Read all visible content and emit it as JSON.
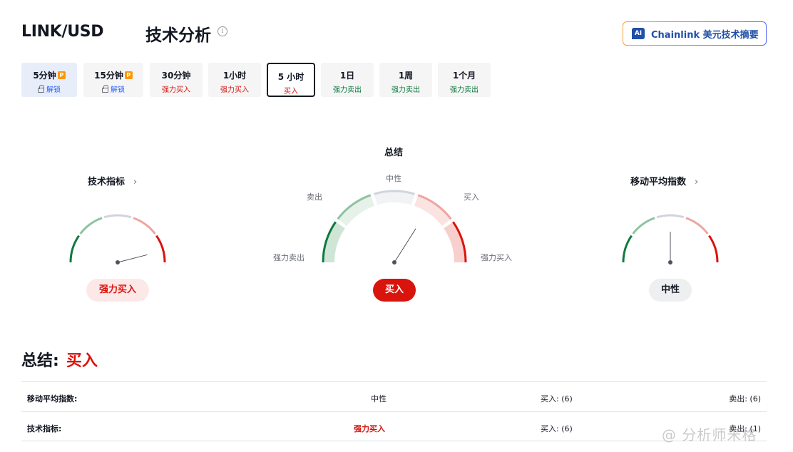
{
  "header": {
    "pair": "LINK/USD",
    "title": "技术分析",
    "info_icon": "i",
    "ai_button": {
      "badge": "AI",
      "label": "Chainlink 美元技术摘要"
    }
  },
  "tabs": [
    {
      "label": "5分钟",
      "sub": "解锁",
      "locked": true,
      "pro_badge": "P"
    },
    {
      "label": "15分钟",
      "sub": "解锁",
      "locked": true,
      "pro_badge": "P"
    },
    {
      "label": "30分钟",
      "sub": "强力买入",
      "sub_color": "red"
    },
    {
      "label": "1小时",
      "sub": "强力买入",
      "sub_color": "red"
    },
    {
      "label": "5 小时",
      "sub": "买入",
      "sub_color": "red",
      "active": true
    },
    {
      "label": "1日",
      "sub": "强力卖出",
      "sub_color": "green"
    },
    {
      "label": "1周",
      "sub": "强力卖出",
      "sub_color": "green"
    },
    {
      "label": "1个月",
      "sub": "强力卖出",
      "sub_color": "green"
    }
  ],
  "gauges": {
    "oscillators": {
      "title": "技术指标",
      "chevron": "›",
      "result": "强力买入",
      "level": 0.92
    },
    "summary": {
      "title": "总结",
      "labels": {
        "strong_sell": "强力卖出",
        "sell": "卖出",
        "neutral": "中性",
        "buy": "买入",
        "strong_buy": "强力买入"
      },
      "result": "买入",
      "level": 0.68
    },
    "moving_averages": {
      "title": "移动平均指数",
      "chevron": "›",
      "result": "中性",
      "level": 0.5
    }
  },
  "summary": {
    "heading": "总结:",
    "value": "买入",
    "rows": [
      {
        "name": "移动平均指数:",
        "status": "中性",
        "status_color": "neutral",
        "buy": "买入: (6)",
        "sell": "卖出: (6)"
      },
      {
        "name": "技术指标:",
        "status": "强力买入",
        "status_color": "red",
        "buy": "买入: (6)",
        "sell": "卖出: (1)"
      }
    ]
  },
  "watermark": "@ 分析师米格",
  "colors": {
    "red": "#d9140c",
    "green": "#0e7a3e",
    "neutral_gray": "#d1d4dc",
    "link_blue": "#1f4fa8"
  }
}
